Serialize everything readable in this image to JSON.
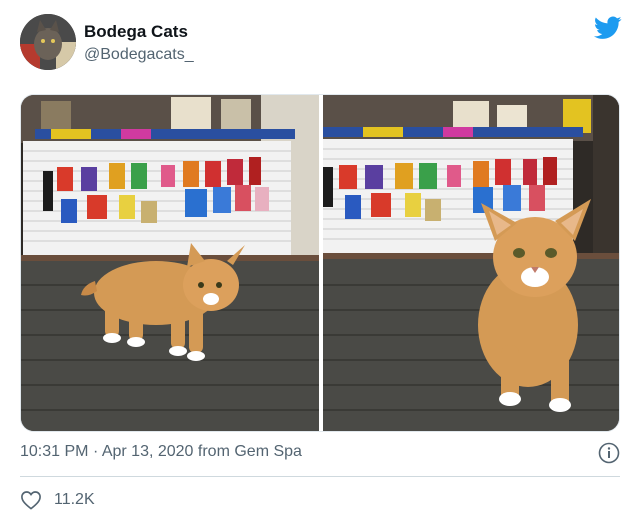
{
  "author": {
    "display_name": "Bodega Cats",
    "handle": "@Bodegacats_"
  },
  "media": {
    "photos": [
      "cat-walking-left",
      "cat-walking-toward-camera"
    ]
  },
  "meta": {
    "time": "10:31 PM",
    "separator": "·",
    "date": "Apr 13, 2020",
    "source": "from Gem Spa"
  },
  "engagement": {
    "likes": "11.2K"
  },
  "colors": {
    "brand": "#1d9bf0",
    "secondary_text": "#536471",
    "divider": "#cfd9de"
  }
}
